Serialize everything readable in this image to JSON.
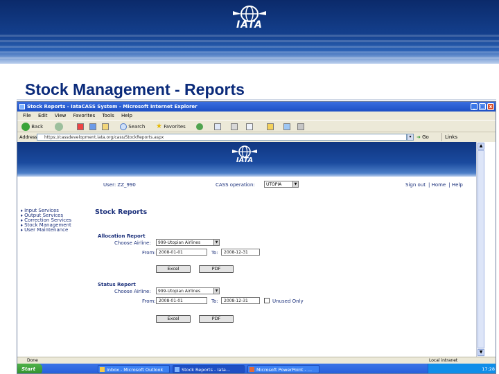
{
  "slide": {
    "logo_text": "IATA",
    "title": "Stock Management - Reports"
  },
  "browser": {
    "window_title": "Stock Reports - IataCASS System - Microsoft Internet Explorer",
    "menu": [
      "File",
      "Edit",
      "View",
      "Favorites",
      "Tools",
      "Help"
    ],
    "toolbar": {
      "back_label": "Back",
      "search_label": "Search",
      "favorites_label": "Favorites"
    },
    "address": {
      "label": "Address",
      "url": "https://cassdevelopment.iata.org/cass/StockReports.aspx",
      "go_label": "Go",
      "links_label": "Links"
    },
    "status": {
      "text": "Done",
      "zone": "Local intranet"
    },
    "taskbar": {
      "start_label": "Start",
      "tasks": [
        "Inbox - Microsoft Outlook",
        "Stock Reports - Iata...",
        "Microsoft PowerPoint - ..."
      ],
      "clock": "17:28"
    }
  },
  "page": {
    "logo_text": "IATA",
    "user_label": "User: ZZ_990",
    "cass_label": "CASS operation:",
    "cass_value": "UTOPIA",
    "top_links": [
      "Sign out",
      "Home",
      "Help"
    ],
    "nav": [
      "Input Services",
      "Output Services",
      "Correction Services",
      "Stock Management",
      "User Maintenance"
    ],
    "heading": "Stock Reports",
    "allocation": {
      "heading": "Allocation Report",
      "airline_label": "Choose Airline:",
      "airline_value": "999-Utopian Airlines",
      "from_label": "From:",
      "from_value": "2008-01-01",
      "to_label": "To:",
      "to_value": "2008-12-31",
      "excel_label": "Excel",
      "pdf_label": "PDF"
    },
    "status_report": {
      "heading": "Status Report",
      "airline_label": "Choose Airline:",
      "airline_value": "999-Utopian Airlines",
      "from_label": "From:",
      "from_value": "2008-01-01",
      "to_label": "To:",
      "to_value": "2008-12-31",
      "unused_label": "Unused Only",
      "excel_label": "Excel",
      "pdf_label": "PDF"
    }
  },
  "colors": {
    "title": "#0a2a7a",
    "header_dark": "#0b2a6a",
    "page_text": "#1a2f7a"
  }
}
